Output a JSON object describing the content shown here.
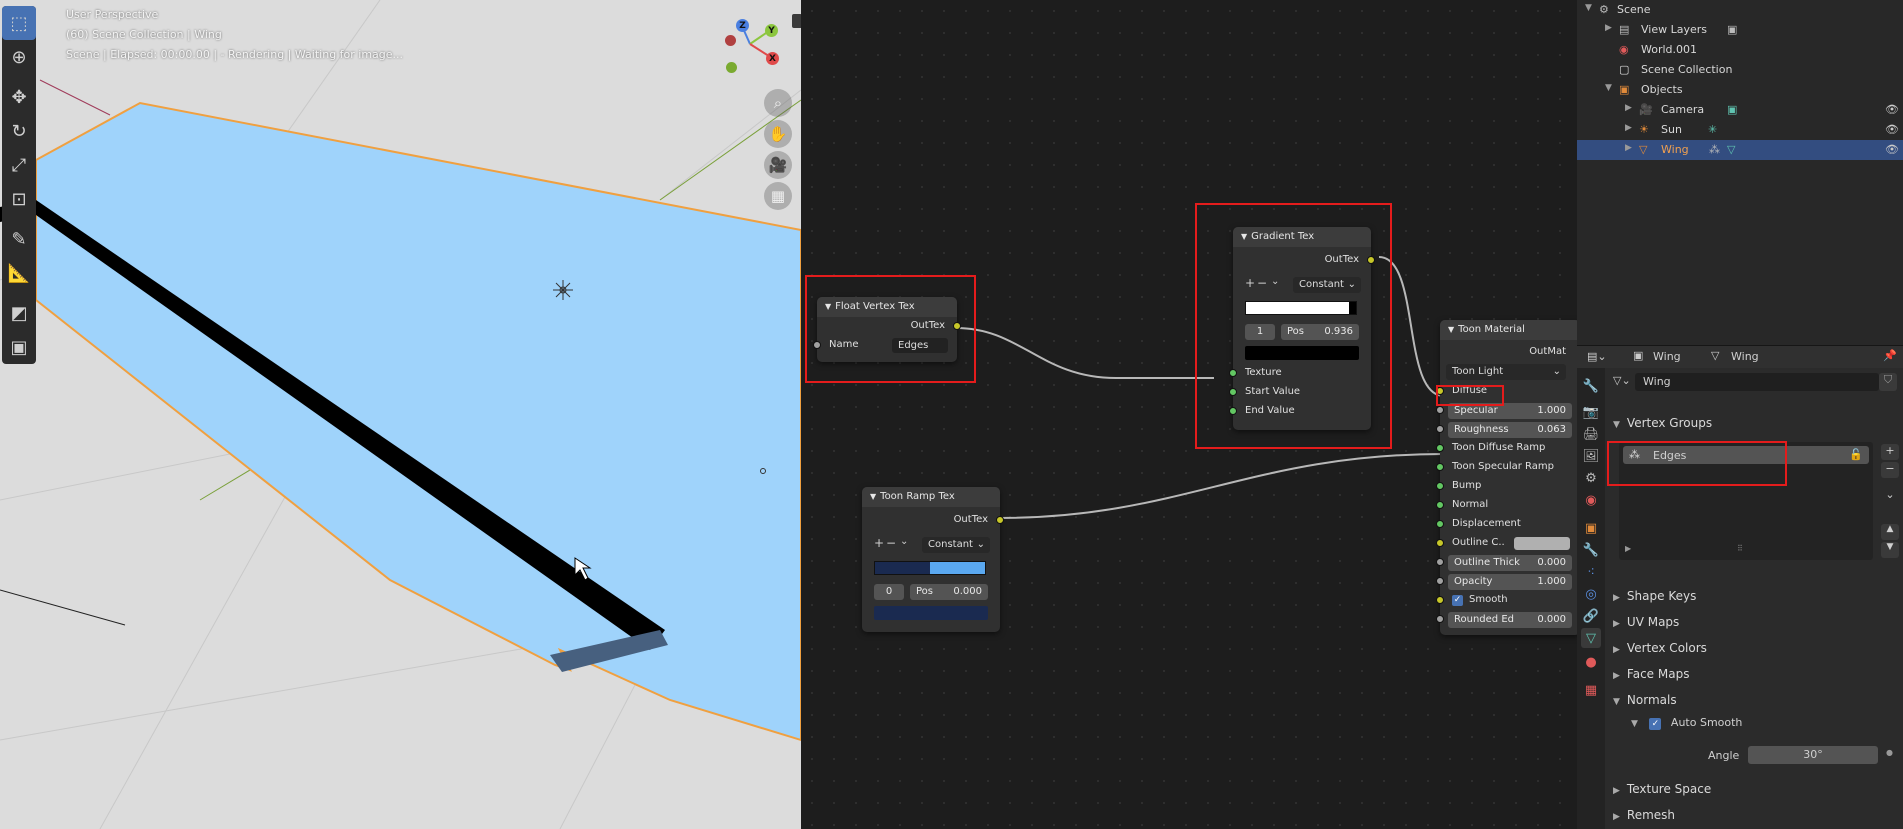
{
  "viewport": {
    "line1": "User Perspective",
    "line2": "(60) Scene Collection | Wing",
    "line3": "Scene | Elapsed: 00:00.00 | - Rendering | Waiting for image...",
    "gizmo": {
      "z": "Z",
      "y": "Y",
      "x": "X"
    },
    "tools": [
      "select-box-icon",
      "cursor-icon",
      "move-icon",
      "rotate-icon",
      "scale-icon",
      "transform-icon",
      "annotate-icon",
      "measure-icon",
      "bevel-icon",
      "loopcut-icon"
    ],
    "nav": [
      "zoom-icon",
      "hand-icon",
      "camera-icon",
      "grid-icon"
    ]
  },
  "nodes": {
    "float_vertex_tex": {
      "title": "Float Vertex Tex",
      "out": "OutTex",
      "name_label": "Name",
      "name_value": "Edges"
    },
    "gradient_tex": {
      "title": "Gradient Tex",
      "out": "OutTex",
      "mode": "Constant",
      "stop_index": "1",
      "pos_label": "Pos",
      "pos_value": "0.936",
      "inputs": [
        "Texture",
        "Start Value",
        "End Value"
      ]
    },
    "toon_ramp_tex": {
      "title": "Toon Ramp Tex",
      "out": "OutTex",
      "mode": "Constant",
      "stop_index": "0",
      "pos_label": "Pos",
      "pos_value": "0.000"
    },
    "toon_material": {
      "title": "Toon Material",
      "out": "OutMat",
      "shader": "Toon Light",
      "diffuse": "Diffuse",
      "specular": {
        "label": "Specular",
        "value": "1.000"
      },
      "roughness": {
        "label": "Roughness",
        "value": "0.063"
      },
      "toon_diffuse_ramp": "Toon Diffuse Ramp",
      "toon_specular_ramp": "Toon Specular Ramp",
      "bump": "Bump",
      "normal": "Normal",
      "displacement": "Displacement",
      "outline_color": "Outline C..",
      "outline_thick": {
        "label": "Outline Thick",
        "value": "0.000"
      },
      "opacity": {
        "label": "Opacity",
        "value": "1.000"
      },
      "smooth": "Smooth",
      "rounded_edges": {
        "label": "Rounded Ed",
        "value": "0.000"
      }
    }
  },
  "outliner": {
    "scene": "Scene",
    "view_layers": "View Layers",
    "world": "World.001",
    "scene_collection": "Scene Collection",
    "objects": "Objects",
    "camera": "Camera",
    "sun": "Sun",
    "wing": "Wing"
  },
  "properties": {
    "header_object": "Wing",
    "header_data": "Wing",
    "mesh_name": "Wing",
    "vertex_groups_title": "Vertex Groups",
    "vertex_group_item": "Edges",
    "panels": [
      "Shape Keys",
      "UV Maps",
      "Vertex Colors",
      "Face Maps",
      "Normals",
      "Texture Space",
      "Remesh"
    ],
    "auto_smooth": "Auto Smooth",
    "angle_label": "Angle",
    "angle_value": "30°"
  },
  "colors": {
    "wing": "#9fd3fb",
    "highlight": "#e41c1c",
    "selection": "#334d80",
    "socket_yellow": "#c7c729",
    "socket_green": "#63c763"
  }
}
